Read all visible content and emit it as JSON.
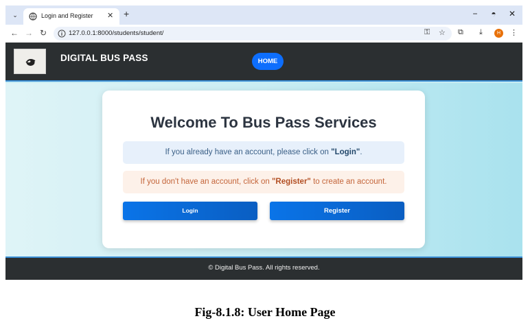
{
  "browser": {
    "tab_title": "Login and Register",
    "url": "127.0.0.1:8000/students/student/",
    "profile_initial": "H",
    "icons": [
      "tab-menu-icon",
      "globe-icon",
      "close-icon",
      "plus-icon",
      "minimize-icon",
      "restore-icon",
      "window-close-icon",
      "back-icon",
      "forward-icon",
      "reload-icon",
      "site-info-icon",
      "password-key-icon",
      "star-icon",
      "extensions-icon",
      "download-icon",
      "more-icon"
    ]
  },
  "site": {
    "brand": "DIGITAL BUS PASS",
    "home_label": "HOME",
    "welcome_title": "Welcome To Bus Pass Services",
    "login_text_before": "If you already have an account, please click on ",
    "login_text_bold": "\"Login\"",
    "login_text_after": ".",
    "register_text_before": "If you don't have an account, click on ",
    "register_text_bold": "\"Register\"",
    "register_text_after": " to create an account.",
    "login_button": "Login",
    "register_button": "Register",
    "footer": "© Digital Bus Pass. All rights reserved.",
    "colors": {
      "navbar": "#2b2f31",
      "accent": "#0d6efd",
      "login_alert_bg": "#e7f0fb",
      "register_alert_bg": "#fdf1e9"
    }
  },
  "caption": "Fig-8.1.8: User Home Page"
}
